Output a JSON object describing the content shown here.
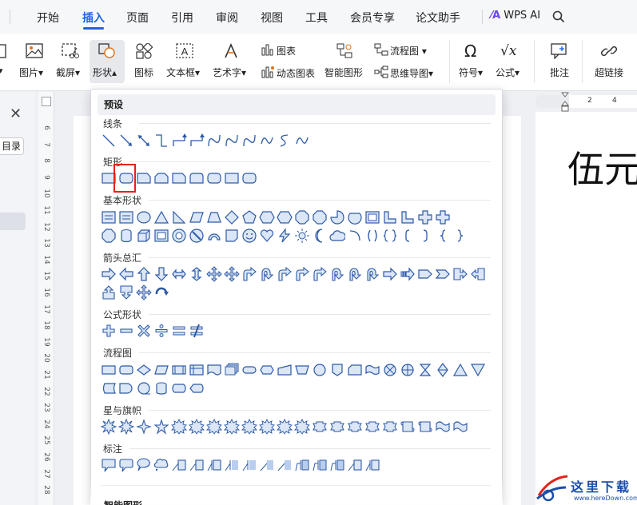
{
  "menubar": {
    "tabs": [
      "开始",
      "插入",
      "页面",
      "引用",
      "审阅",
      "视图",
      "工具",
      "会员专享",
      "论文助手"
    ],
    "active_tab": "插入",
    "wps_ai": "WPS AI"
  },
  "ribbon": {
    "picture": "图片",
    "screenshot": "截屏",
    "shape": "形状",
    "icon": "图标",
    "textbox": "文本框",
    "wordart": "艺术字",
    "chart": "图表",
    "dynamic_chart": "动态图表",
    "smart_graphic": "智能图形",
    "flowchart": "流程图",
    "mindmap": "思维导图",
    "symbol": "符号",
    "formula": "公式",
    "comment": "批注",
    "hyperlink": "超链接"
  },
  "nav": {
    "toc_label": "目录"
  },
  "vruler": {
    "ticks": [
      "6",
      "7",
      "8",
      "9",
      "10",
      "11",
      "12",
      "13",
      "14",
      "15",
      "16",
      "17",
      "18",
      "19",
      "20",
      "21",
      "22",
      "23",
      "24",
      "25",
      "26",
      "27",
      "28"
    ]
  },
  "hruler": {
    "ticks": [
      "2",
      "4"
    ]
  },
  "document": {
    "heading": "伍元"
  },
  "gallery": {
    "preset_title": "预设",
    "categories": {
      "lines": "线条",
      "rectangles": "矩形",
      "basic": "基本形状",
      "arrows": "箭头总汇",
      "formula": "公式形状",
      "flowchart": "流程图",
      "stars": "星与旗帜",
      "callouts": "标注",
      "smart": "智能图形"
    },
    "highlighted_shape": "rounded-rectangle"
  },
  "watermark": {
    "text": "这里下载",
    "url": "www.hereDown.com"
  },
  "colors": {
    "accent": "#1d63e6",
    "highlight": "#e2231a",
    "shape_stroke": "#2d5aa6",
    "shape_fill": "#dbe6f7"
  }
}
